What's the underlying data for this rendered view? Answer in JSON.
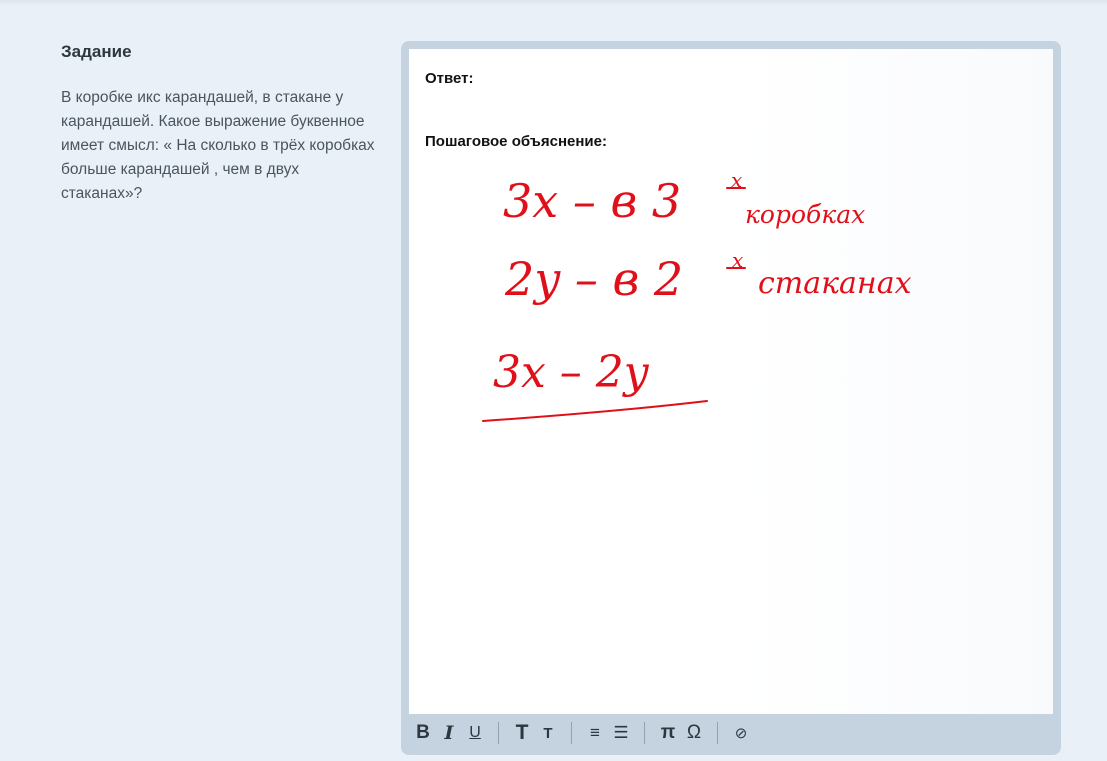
{
  "task": {
    "title": "Задание",
    "text": "В коробке икс карандашей, в стакане у карандашей. Какое выражение буквенное имеет смысл: « На сколько в трёх коробках больше карандашей , чем в двух стаканах»?"
  },
  "editor": {
    "answer_label": "Ответ:",
    "explanation_label": "Пошаговое объяснение:",
    "handwriting": {
      "line1": "3x  – в 3",
      "line1_sup": "х",
      "line1_tail": "коробках",
      "line2": "2y  –  в 2",
      "line2_sup": "х",
      "line2_tail": "стаканах",
      "line3": "3x – 2y",
      "color": "#e0101a"
    },
    "toolbar": {
      "bold": "B",
      "italic": "I",
      "underline": "U",
      "text_large": "T",
      "text_small": "T",
      "numbered_list": "≡",
      "bullet_list": "☰",
      "pi": "π",
      "omega": "Ω",
      "attach": "⊘"
    }
  },
  "colors": {
    "background": "#e9f0f7",
    "editor_frame": "#c4d3df",
    "ink": "#e0101a"
  }
}
